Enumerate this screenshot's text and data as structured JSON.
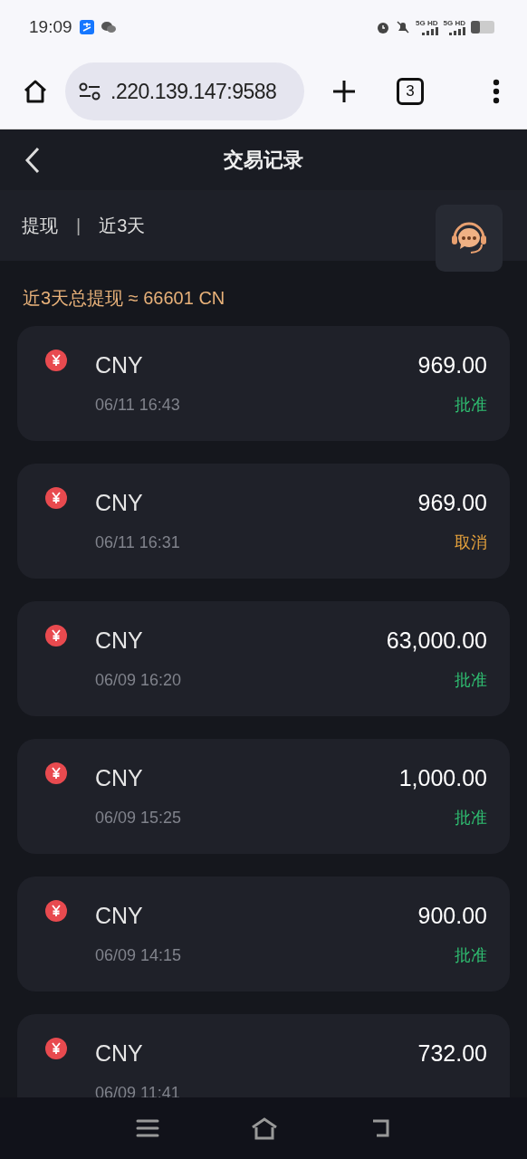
{
  "status_bar": {
    "time": "19:09",
    "network_1": "5G HD",
    "network_2": "5G HD"
  },
  "browser": {
    "url": ".220.139.147:9588",
    "tab_count": "3"
  },
  "header": {
    "title": "交易记录"
  },
  "filter": {
    "type": "提现",
    "separator": "|",
    "range": "近3天"
  },
  "summary": "近3天总提现 ≈ 66601 CN",
  "records": [
    {
      "currency": "CNY",
      "time": "06/11 16:43",
      "amount": "969.00",
      "status": "批准",
      "kind": "approved"
    },
    {
      "currency": "CNY",
      "time": "06/11 16:31",
      "amount": "969.00",
      "status": "取消",
      "kind": "cancelled"
    },
    {
      "currency": "CNY",
      "time": "06/09 16:20",
      "amount": "63,000.00",
      "status": "批准",
      "kind": "approved"
    },
    {
      "currency": "CNY",
      "time": "06/09 15:25",
      "amount": "1,000.00",
      "status": "批准",
      "kind": "approved"
    },
    {
      "currency": "CNY",
      "time": "06/09 14:15",
      "amount": "900.00",
      "status": "批准",
      "kind": "approved"
    },
    {
      "currency": "CNY",
      "time": "06/09 11:41",
      "amount": "732.00"
    }
  ]
}
